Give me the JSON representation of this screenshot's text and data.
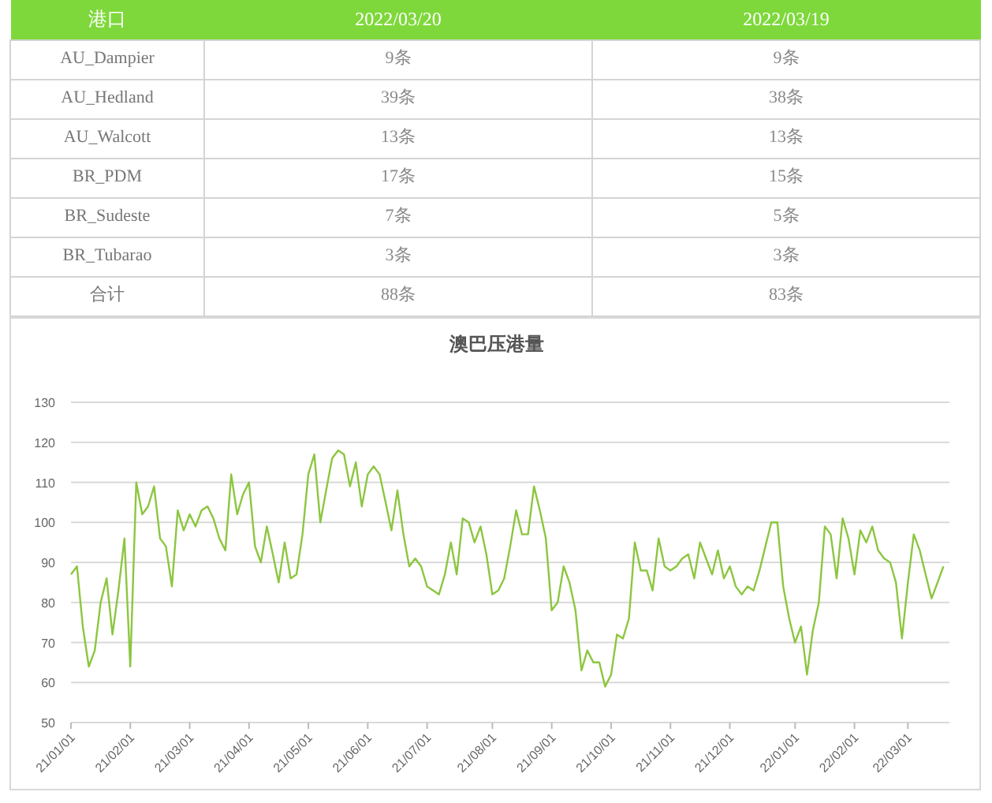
{
  "table": {
    "columns": [
      "港口",
      "2022/03/20",
      "2022/03/19"
    ],
    "rows": [
      [
        "AU_Dampier",
        "9条",
        "9条"
      ],
      [
        "AU_Hedland",
        "39条",
        "38条"
      ],
      [
        "AU_Walcott",
        "13条",
        "13条"
      ],
      [
        "BR_PDM",
        "17条",
        "15条"
      ],
      [
        "BR_Sudeste",
        "7条",
        "5条"
      ],
      [
        "BR_Tubarao",
        "3条",
        "3条"
      ],
      [
        "合计",
        "88条",
        "83条"
      ]
    ]
  },
  "chart": {
    "chart_data": {
      "type": "line",
      "title": "澳巴压港量",
      "categories": [
        "21/01/01",
        null,
        null,
        null,
        null,
        null,
        null,
        null,
        null,
        null,
        "21/02/01",
        null,
        null,
        null,
        null,
        null,
        null,
        null,
        null,
        null,
        "21/03/01",
        null,
        null,
        null,
        null,
        null,
        null,
        null,
        null,
        null,
        "21/04/01",
        null,
        null,
        null,
        null,
        null,
        null,
        null,
        null,
        null,
        "21/05/01",
        null,
        null,
        null,
        null,
        null,
        null,
        null,
        null,
        null,
        "21/06/01",
        null,
        null,
        null,
        null,
        null,
        null,
        null,
        null,
        null,
        "21/07/01",
        null,
        null,
        null,
        null,
        null,
        null,
        null,
        null,
        null,
        null,
        "21/08/01",
        null,
        null,
        null,
        null,
        null,
        null,
        null,
        null,
        null,
        "21/09/01",
        null,
        null,
        null,
        null,
        null,
        null,
        null,
        null,
        null,
        "21/10/01",
        null,
        null,
        null,
        null,
        null,
        null,
        null,
        null,
        null,
        "21/11/01",
        null,
        null,
        null,
        null,
        null,
        null,
        null,
        null,
        null,
        "21/12/01",
        null,
        null,
        null,
        null,
        null,
        null,
        null,
        null,
        null,
        null,
        "22/01/01",
        null,
        null,
        null,
        null,
        null,
        null,
        null,
        null,
        null,
        "22/02/01",
        null,
        null,
        null,
        null,
        null,
        null,
        null,
        null,
        "22/03/01",
        null,
        null,
        null,
        null,
        null,
        null
      ],
      "series": [
        {
          "color": "#8cc63f",
          "values": [
            87,
            89,
            74,
            64,
            68,
            80,
            86,
            72,
            83,
            96,
            64,
            110,
            102,
            104,
            109,
            96,
            94,
            84,
            103,
            98,
            102,
            99,
            103,
            104,
            101,
            96,
            93,
            112,
            102,
            107,
            110,
            94,
            90,
            99,
            92,
            85,
            95,
            86,
            87,
            97,
            112,
            117,
            100,
            108,
            116,
            118,
            117,
            109,
            115,
            104,
            112,
            114,
            112,
            105,
            98,
            108,
            97,
            89,
            91,
            89,
            84,
            83,
            82,
            87,
            95,
            87,
            101,
            100,
            95,
            99,
            92,
            82,
            83,
            86,
            94,
            103,
            97,
            97,
            109,
            103,
            96,
            78,
            80,
            89,
            85,
            78,
            63,
            68,
            65,
            65,
            59,
            62,
            72,
            71,
            76,
            95,
            88,
            88,
            83,
            96,
            89,
            88,
            89,
            91,
            92,
            86,
            95,
            91,
            87,
            93,
            86,
            89,
            84,
            82,
            84,
            83,
            88,
            94,
            100,
            100,
            84,
            76,
            70,
            74,
            62,
            73,
            80,
            99,
            97,
            86,
            101,
            96,
            87,
            98,
            95,
            99,
            93,
            91,
            90,
            85,
            71,
            85,
            97,
            93,
            87,
            81,
            85,
            89
          ]
        }
      ],
      "grid": true,
      "ylim": [
        50,
        130
      ],
      "yticks": [
        50,
        60,
        70,
        80,
        90,
        100,
        110,
        120,
        130
      ]
    }
  }
}
